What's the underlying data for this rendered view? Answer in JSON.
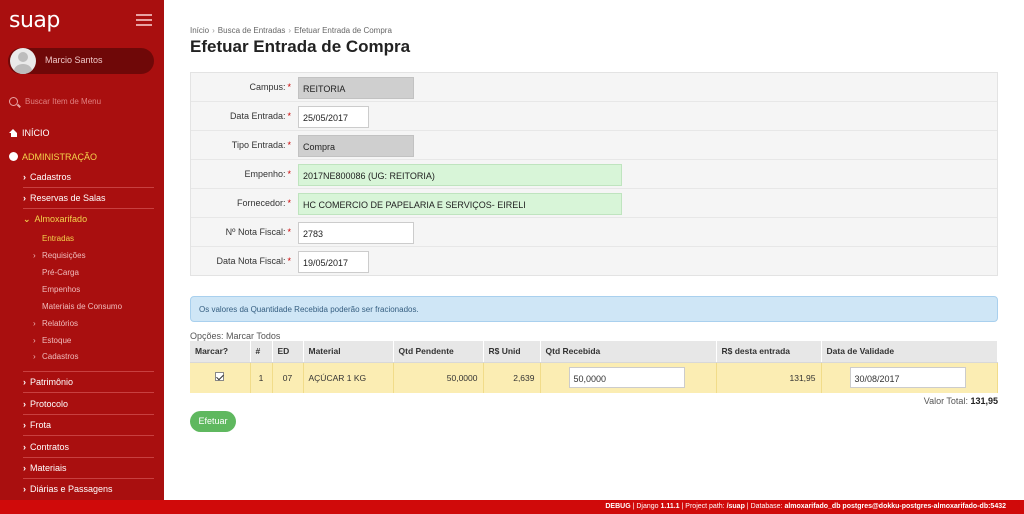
{
  "app": {
    "logo": "suap"
  },
  "user": {
    "name": "Marcio Santos"
  },
  "search": {
    "placeholder": "Buscar Item de Menu"
  },
  "nav": {
    "inicio": "INÍCIO",
    "administracao": "ADMINISTRAÇÃO",
    "cadastros": "Cadastros",
    "reservas": "Reservas de Salas",
    "almoxarifado": "Almoxarifado",
    "almox_items": [
      "Entradas",
      "Requisições",
      "Pré-Carga",
      "Empenhos",
      "Materiais de Consumo",
      "Relatórios",
      "Estoque",
      "Cadastros"
    ],
    "patrimonio": "Patrimônio",
    "protocolo": "Protocolo",
    "frota": "Frota",
    "contratos": "Contratos",
    "materiais": "Materiais",
    "diarias": "Diárias e Passagens"
  },
  "breadcrumb": [
    "Início",
    "Busca de Entradas",
    "Efetuar Entrada de Compra"
  ],
  "page_title": "Efetuar Entrada de Compra",
  "form": {
    "campus_label": "Campus:",
    "campus_value": "REITORIA",
    "data_entrada_label": "Data Entrada:",
    "data_entrada_value": "25/05/2017",
    "tipo_entrada_label": "Tipo Entrada:",
    "tipo_entrada_value": "Compra",
    "empenho_label": "Empenho:",
    "empenho_value": "2017NE800086 (UG: REITORIA)",
    "fornecedor_label": "Fornecedor:",
    "fornecedor_value": "HC COMERCIO DE PAPELARIA E SERVIÇOS- EIRELI",
    "nota_fiscal_label": "Nº Nota Fiscal:",
    "nota_fiscal_value": "2783",
    "data_nota_label": "Data Nota Fiscal:",
    "data_nota_value": "19/05/2017",
    "required_mark": "*"
  },
  "info_message": "Os valores da Quantidade Recebida poderão ser fracionados.",
  "opcoes": "Opções: Marcar Todos",
  "table": {
    "headers": [
      "Marcar?",
      "#",
      "ED",
      "Material",
      "Qtd Pendente",
      "R$ Unid",
      "Qtd Recebida",
      "R$ desta entrada",
      "Data de Validade"
    ],
    "row": {
      "num": "1",
      "ed": "07",
      "material": "AÇÚCAR 1 KG",
      "qtd_pendente": "50,0000",
      "unid": "2,639",
      "qtd_recebida": "50,0000",
      "valor_entrada": "131,95",
      "validade": "30/08/2017"
    }
  },
  "total": {
    "label": "Valor Total:",
    "value": "131,95"
  },
  "submit_label": "Efetuar",
  "footer": {
    "debug": "DEBUG",
    "django_label": "Django",
    "django_version": "1.11.1",
    "path_label": "Project path:",
    "path_value": "/suap",
    "db_label": "Database:",
    "db_value": "almoxarifado_db postgres@dokku-postgres-almoxarifado-db:5432"
  }
}
